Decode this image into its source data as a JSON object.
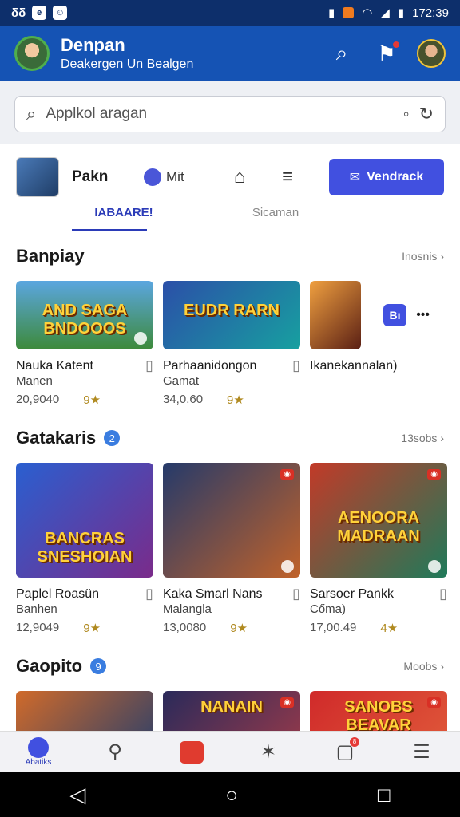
{
  "status": {
    "time": "172:39",
    "left_icons": [
      "δδ",
      "e",
      "☺"
    ]
  },
  "header": {
    "title": "Denpan",
    "subtitle": "Deakergen Un Bealgen"
  },
  "search": {
    "placeholder": "Applkol aragan"
  },
  "toolbar": {
    "app_name": "Pakn",
    "mini_label": "Mit",
    "primary_label": "Vendrack"
  },
  "tabs": [
    {
      "label": "IABAARE!"
    },
    {
      "label": "Sicaman"
    }
  ],
  "sections": [
    {
      "title": "Banpiay",
      "more": "Inosnis",
      "cards": [
        {
          "art": "AND SAGA BNDOOOS",
          "title": "Nauka Katent",
          "sub": "Manen",
          "count": "20,9040",
          "stars": "9★"
        },
        {
          "art": "EUDR RARN",
          "title": "Parhaanidongon",
          "sub": "Gamat",
          "count": "34,0.60",
          "stars": "9★"
        },
        {
          "art": "",
          "title": "Ikanekannalan)",
          "sub": "",
          "count": "",
          "stars": ""
        }
      ],
      "pill": "Bı"
    },
    {
      "title": "Gatakaris",
      "badge": "2",
      "more": "13sobs",
      "cards": [
        {
          "art": "BANCRAS SNESHOIAN",
          "title": "Paplel Roasün",
          "sub": "Banhen",
          "count": "12,9049",
          "stars": "9★"
        },
        {
          "art": "",
          "title": "Kaka Smarl Nans",
          "sub": "Malangla",
          "count": "13,0080",
          "stars": "9★"
        },
        {
          "art": "AENOORA MADRAAN",
          "title": "Sarsoer Pankk",
          "sub": "Cőma)",
          "count": "17,00.49",
          "stars": "4★"
        }
      ]
    },
    {
      "title": "Gaopito",
      "badge": "9",
      "more": "Moobs",
      "cards": [
        {
          "art": ""
        },
        {
          "art": "NANAIN"
        },
        {
          "art": "SANOBS BEAVAR"
        }
      ]
    }
  ],
  "bottom_nav": {
    "first_label": "Abatiks"
  }
}
